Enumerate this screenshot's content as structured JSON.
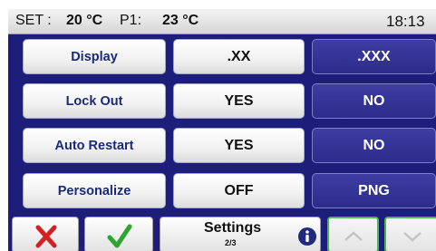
{
  "status_bar": {
    "set_label": "SET :",
    "set_value": "20 °C",
    "p1_label": "P1:",
    "p1_value": "23 °C",
    "time": "18:13"
  },
  "rows": [
    {
      "label": "Display",
      "option_a": ".XX",
      "option_b": ".XXX",
      "selected": "b"
    },
    {
      "label": "Lock Out",
      "option_a": "YES",
      "option_b": "NO",
      "selected": "b"
    },
    {
      "label": "Auto Restart",
      "option_a": "YES",
      "option_b": "NO",
      "selected": "b"
    },
    {
      "label": "Personalize",
      "option_a": "OFF",
      "option_b": "PNG",
      "selected": "b"
    }
  ],
  "bottom_bar": {
    "cancel_icon": "red-x-icon",
    "confirm_icon": "green-check-icon",
    "settings_title": "Settings",
    "settings_page": "2/3",
    "info_icon": "info-icon",
    "up_icon": "chevron-up-icon",
    "down_icon": "chevron-down-icon"
  },
  "colors": {
    "background": "#1d1d7a",
    "selected_button": "#2c2c8c",
    "label_text": "#1a2a7a",
    "cancel": "#d32020",
    "confirm": "#2ea52e",
    "nav_border": "#52b352"
  }
}
